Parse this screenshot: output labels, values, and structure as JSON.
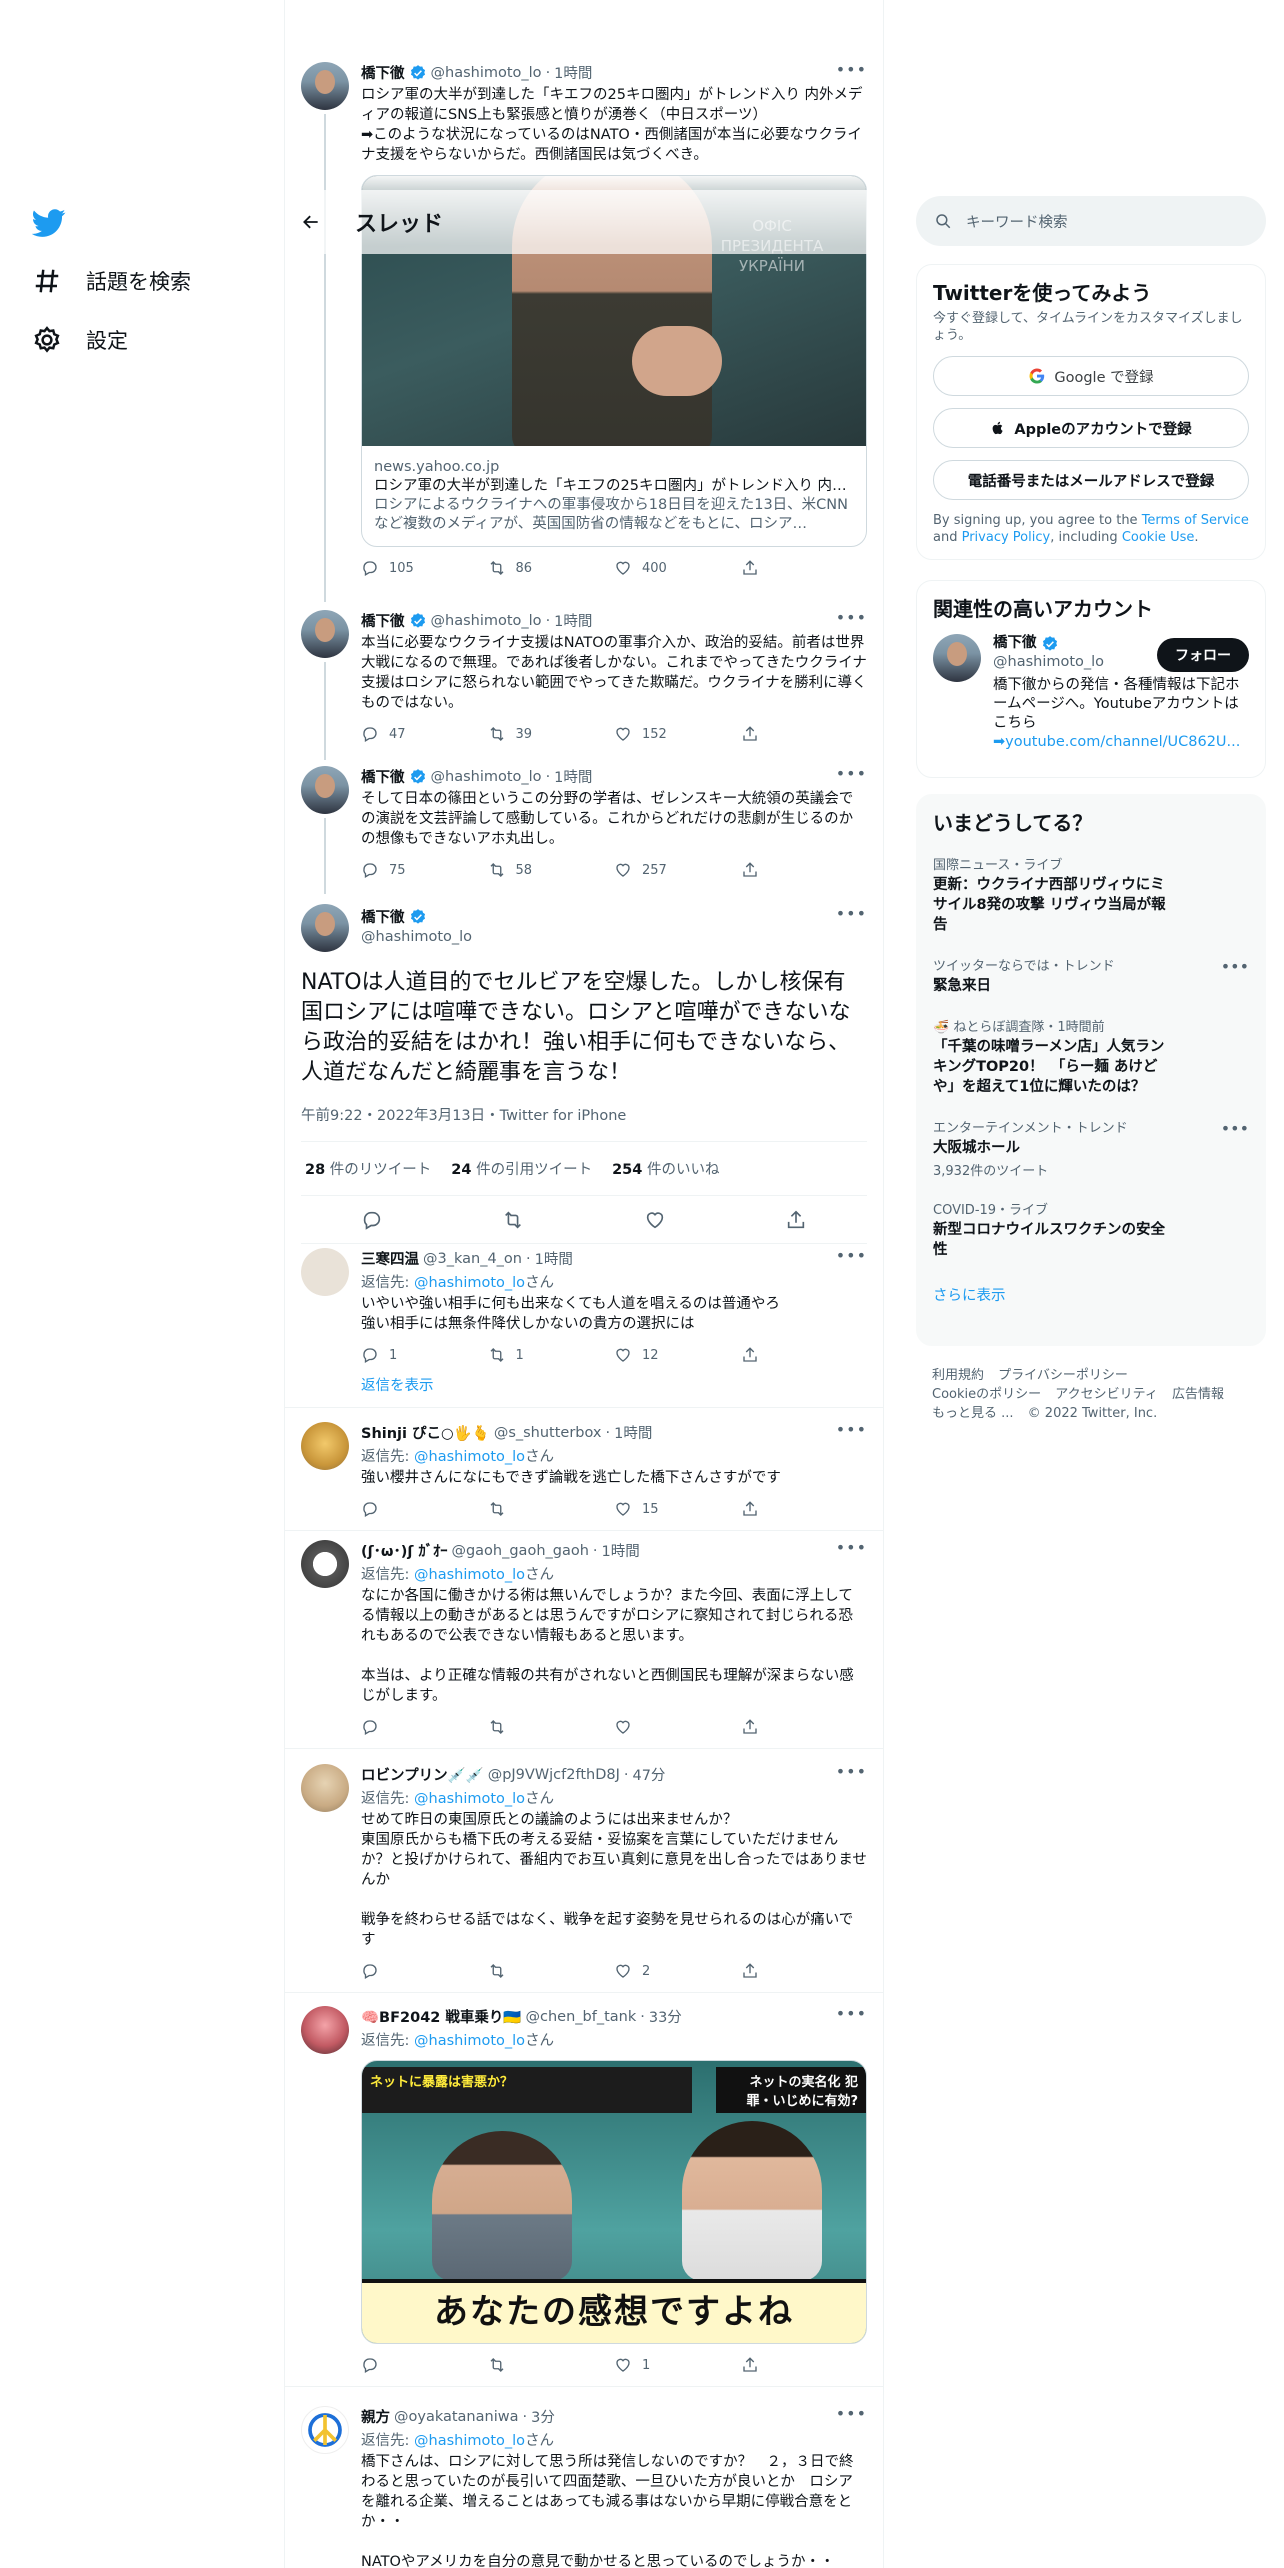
{
  "nav": {
    "explore_label": "話題を検索",
    "settings_label": "設定"
  },
  "header": {
    "title": "スレッド"
  },
  "tweets": [
    {
      "name": "橋下徹",
      "handle": "@hashimoto_lo",
      "time": "1時間",
      "text": "ロシア軍の大半が到達した「キエフの25キロ圏内」がトレンド入り 内外メディアの報道にSNS上も緊張感と憤りが湧巻く（中日スポーツ）\n➡このような状況になっているのはNATO・西側諸国が本当に必要なウクライナ支援をやらないからだ。西側諸国民は気づくべき。",
      "card": {
        "sign_text": "ОФІС ПРЕЗИДЕНТА УКРАЇНИ",
        "domain": "news.yahoo.co.jp",
        "title": "ロシア軍の大半が到達した「キエフの25キロ圏内」がトレンド入り 内外メデ…",
        "desc": "ロシアによるウクライナへの軍事侵攻から18日目を迎えた13日、米CNNなど複数のメディアが、英国国防省の情報などをもとに、ロシア…"
      },
      "replies": "105",
      "retweets": "86",
      "likes": "400"
    },
    {
      "name": "橋下徹",
      "handle": "@hashimoto_lo",
      "time": "1時間",
      "text": "本当に必要なウクライナ支援はNATOの軍事介入か、政治的妥結。前者は世界大戦になるので無理。であれば後者しかない。これまでやってきたウクライナ支援はロシアに怒られない範囲でやってきた欺瞞だ。ウクライナを勝利に導くものではない。",
      "replies": "47",
      "retweets": "39",
      "likes": "152"
    },
    {
      "name": "橋下徹",
      "handle": "@hashimoto_lo",
      "time": "1時間",
      "text": "そして日本の篠田というこの分野の学者は、ゼレンスキー大統領の英議会での演説を文芸評論して感動している。これからどれだけの悲劇が生じるのかの想像もできないアホ丸出し。",
      "replies": "75",
      "retweets": "58",
      "likes": "257"
    }
  ],
  "focused": {
    "name": "橋下徹",
    "handle": "@hashimoto_lo",
    "text": "NATOは人道目的でセルビアを空爆した。しかし核保有国ロシアには喧嘩できない。ロシアと喧嘩ができないなら政治的妥結をはかれ！強い相手に何もできないなら、人道だなんだと綺麗事を言うな！",
    "meta": "午前9:22・2022年3月13日・Twitter for iPhone",
    "retweets": "28",
    "retweets_label": "件のリツイート",
    "quotes": "24",
    "quotes_label": "件の引用ツイート",
    "likes": "254",
    "likes_label": "件のいいね"
  },
  "reply_prefix": "返信先: ",
  "reply_target": "@hashimoto_lo",
  "reply_suffix": "さん",
  "replies": [
    {
      "name": "三寒四温",
      "handle": "@3_kan_4_on",
      "time": "1時間",
      "text": "いやいや強い相手に何も出来なくても人道を唱えるのは普通やろ\n強い相手には無条件降伏しかないの貴方の選択には",
      "replies": "1",
      "retweets": "1",
      "likes": "12",
      "show_replies": "返信を表示"
    },
    {
      "name": "Shinji ぴこ○🖐🫰",
      "handle": "@s_shutterbox",
      "time": "1時間",
      "text": "強い櫻井さんになにもできず論戦を逃亡した橋下さんさすがです",
      "replies": "",
      "retweets": "",
      "likes": "15"
    },
    {
      "name": "(ʃ･ω･)ʃ ｶﾞｵｰ",
      "handle": "@gaoh_gaoh_gaoh",
      "time": "1時間",
      "text": "なにか各国に働きかける術は無いんでしょうか？また今回、表面に浮上してる情報以上の動きがあるとは思うんですがロシアに察知されて封じられる恐れもあるので公表できない情報もあると思います。\n\n本当は、より正確な情報の共有がされないと西側国民も理解が深まらない感じがします。",
      "replies": "",
      "retweets": "",
      "likes": ""
    },
    {
      "name": "ロビンプリン💉💉",
      "handle": "@pJ9VWjcf2fthD8J",
      "time": "47分",
      "text": "せめて昨日の東国原氏との議論のようには出来ませんか？\n東国原氏からも橋下氏の考える妥結・妥協案を言葉にしていただけませんか？と投げかけられて、番組内でお互い真剣に意見を出し合ったではありませんか\n\n戦争を終わらせる話ではなく、戦争を起す姿勢を見せられるのは心が痛いです",
      "replies": "",
      "retweets": "",
      "likes": "2"
    },
    {
      "name": "🧠BF2042 戦車乗り🇺🇦",
      "handle": "@chen_bf_tank",
      "time": "33分",
      "text": "",
      "media": {
        "banner_left": "ネットに暴露は害悪か？",
        "banner_right": "ネットの実名化 犯罪・いじめに有効?",
        "caption": "あなたの感想ですよね"
      },
      "replies": "",
      "retweets": "",
      "likes": "1"
    },
    {
      "name": "親方",
      "handle": "@oyakatananiwa",
      "time": "3分",
      "text": "橋下さんは、ロシアに対して思う所は発信しないのですか？　２，３日で終わると思っていたのが長引いて四面楚歌、一旦ひいた方が良いとか　ロシアを離れる企業、増えることはあっても減る事はないから早期に停戦合意をとか・・\n\nNATOやアメリカを自分の意見で動かせると思っているのでしょうか・・"
    }
  ],
  "right": {
    "search_placeholder": "キーワード検索",
    "signup": {
      "title": "Twitterを使ってみよう",
      "sub": "今すぐ登録して、タイムラインをカスタマイズしましょう。",
      "google": "Google で登録",
      "apple": "Appleのアカウントで登録",
      "phone": "電話番号またはメールアドレスで登録",
      "legal_prefix": "By signing up, you agree to the ",
      "terms": "Terms of Service",
      "and": " and ",
      "privacy": "Privacy Policy",
      "including": ", including ",
      "cookie": "Cookie Use",
      "dot": "."
    },
    "related": {
      "title": "関連性の高いアカウント",
      "name": "橋下徹",
      "handle": "@hashimoto_lo",
      "follow": "フォロー",
      "bio": "橋下徹からの発信・各種情報は下記ホームページへ。Youtubeアカウントはこちら",
      "bio_link": "➡youtube.com/channel/UC862U..."
    },
    "trends": {
      "title": "いまどうしてる？",
      "items": [
        {
          "category": "国際ニュース・ライブ",
          "title": "更新：ウクライナ西部リヴィウにミサイル8発の攻撃 リヴィウ当局が報告",
          "count": ""
        },
        {
          "category": "ツイッターならでは・トレンド",
          "title": "緊急来日",
          "count": ""
        },
        {
          "category": "🍜 ねとらぼ調査隊・1時間前",
          "title": "「千葉の味噌ラーメン店」人気ランキングTOP20！　「らー麺 あけどや」を超えて1位に輝いたのは？",
          "count": ""
        },
        {
          "category": "エンターテインメント・トレンド",
          "title": "大阪城ホール",
          "count": "3,932件のツイート"
        },
        {
          "category": "COVID-19・ライブ",
          "title": "新型コロナウイルスワクチンの安全性",
          "count": ""
        }
      ],
      "show_more": "さらに表示"
    },
    "footer": {
      "terms": "利用規約",
      "privacy": "プライバシーポリシー",
      "cookie": "Cookieのポリシー",
      "access": "アクセシビリティ",
      "ads": "広告情報",
      "more": "もっと見る ...",
      "copyright": "© 2022 Twitter, Inc."
    }
  },
  "colors": {
    "accent": "#1d9bf0",
    "text": "#0f1419",
    "muted": "#536471",
    "border": "#eff3f4"
  }
}
